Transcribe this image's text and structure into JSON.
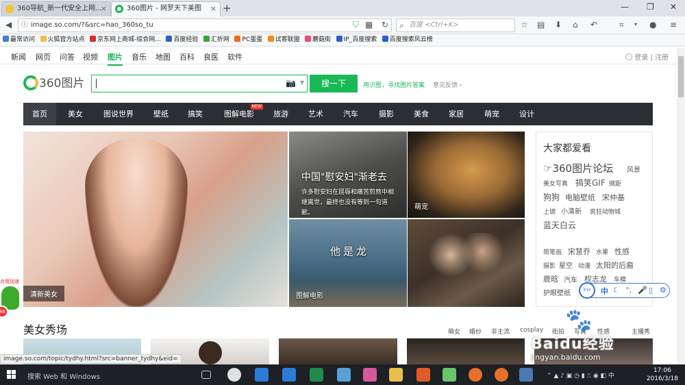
{
  "browser": {
    "tabs": [
      {
        "title": "360导航_新一代安全上网...",
        "active": false
      },
      {
        "title": "360图片 - 网罗天下美图",
        "active": true
      }
    ],
    "url": "image.so.com/?&src=hao_360so_tu",
    "search_placeholder": "百度 <Ctrl+K>",
    "bookmarks": [
      "最常访问",
      "火狐官方站点",
      "京东网上商城-综合网...",
      "百度经验",
      "汇折网",
      "PC蛋蛋",
      "试客联盟",
      "蘑菇街",
      "IP_百度搜索",
      "百度搜索风云榜"
    ]
  },
  "topnav": {
    "items": [
      "新闻",
      "网页",
      "问答",
      "视频",
      "图片",
      "音乐",
      "地图",
      "百科",
      "良医",
      "软件"
    ],
    "active": "图片",
    "login": "登录",
    "register": "注册"
  },
  "search": {
    "logo_text": "360图片",
    "button": "搜一下",
    "link1": "用识图，寻找图片答案",
    "link2": "意见反馈"
  },
  "categories": {
    "items": [
      "首页",
      "美女",
      "图说世界",
      "壁纸",
      "搞笑",
      "图解电影",
      "旅游",
      "艺术",
      "汽车",
      "摄影",
      "美食",
      "家居",
      "萌宠",
      "设计"
    ],
    "active": "首页",
    "new_badge": "NEW"
  },
  "grid": {
    "main_caption": "清新美女",
    "news_title": "中国\"慰安妇\"渐老去",
    "news_sub": "许多慰安妇在屈辱和痛苦煎熬中相继离世，最终也没有等到一句道歉。",
    "cat_caption": "萌宠",
    "movie_caption": "图解电影",
    "movie_overlay": "他是龙"
  },
  "sidebar": {
    "title": "大家都爱看",
    "tags": [
      "☞360图片论坛",
      "风景",
      "美女写真",
      "搞笑GIF",
      "微距",
      "狗狗",
      "电脑壁纸",
      "宋仲基",
      "上镜",
      "小清新",
      "疯狂动物城",
      "蓝天白云",
      "简笔画",
      "宋慧乔",
      "水果",
      "性感",
      "摄影",
      "星空",
      "动漫",
      "太阳的后裔",
      "鹿晗",
      "汽车",
      "权志龙",
      "车模",
      "护眼壁纸"
    ]
  },
  "ifly": {
    "logo": "iFLY",
    "mode": "中"
  },
  "section": {
    "title": "美女秀场",
    "tags": [
      "萌女",
      "婚纱",
      "非主流",
      "cosplay",
      "街拍",
      "写真",
      "性感",
      "主播秀"
    ]
  },
  "status_url": "image.so.com/topic/tydhy.html?src=banner_tydhy&eid=",
  "float_widget": "点我加速",
  "watermark": {
    "text": "Baidu经验",
    "url": "jingyan.baidu.com"
  },
  "taskbar": {
    "search": "搜索 Web 和 Windows",
    "time": "17:06",
    "date": "2016/3/18"
  }
}
